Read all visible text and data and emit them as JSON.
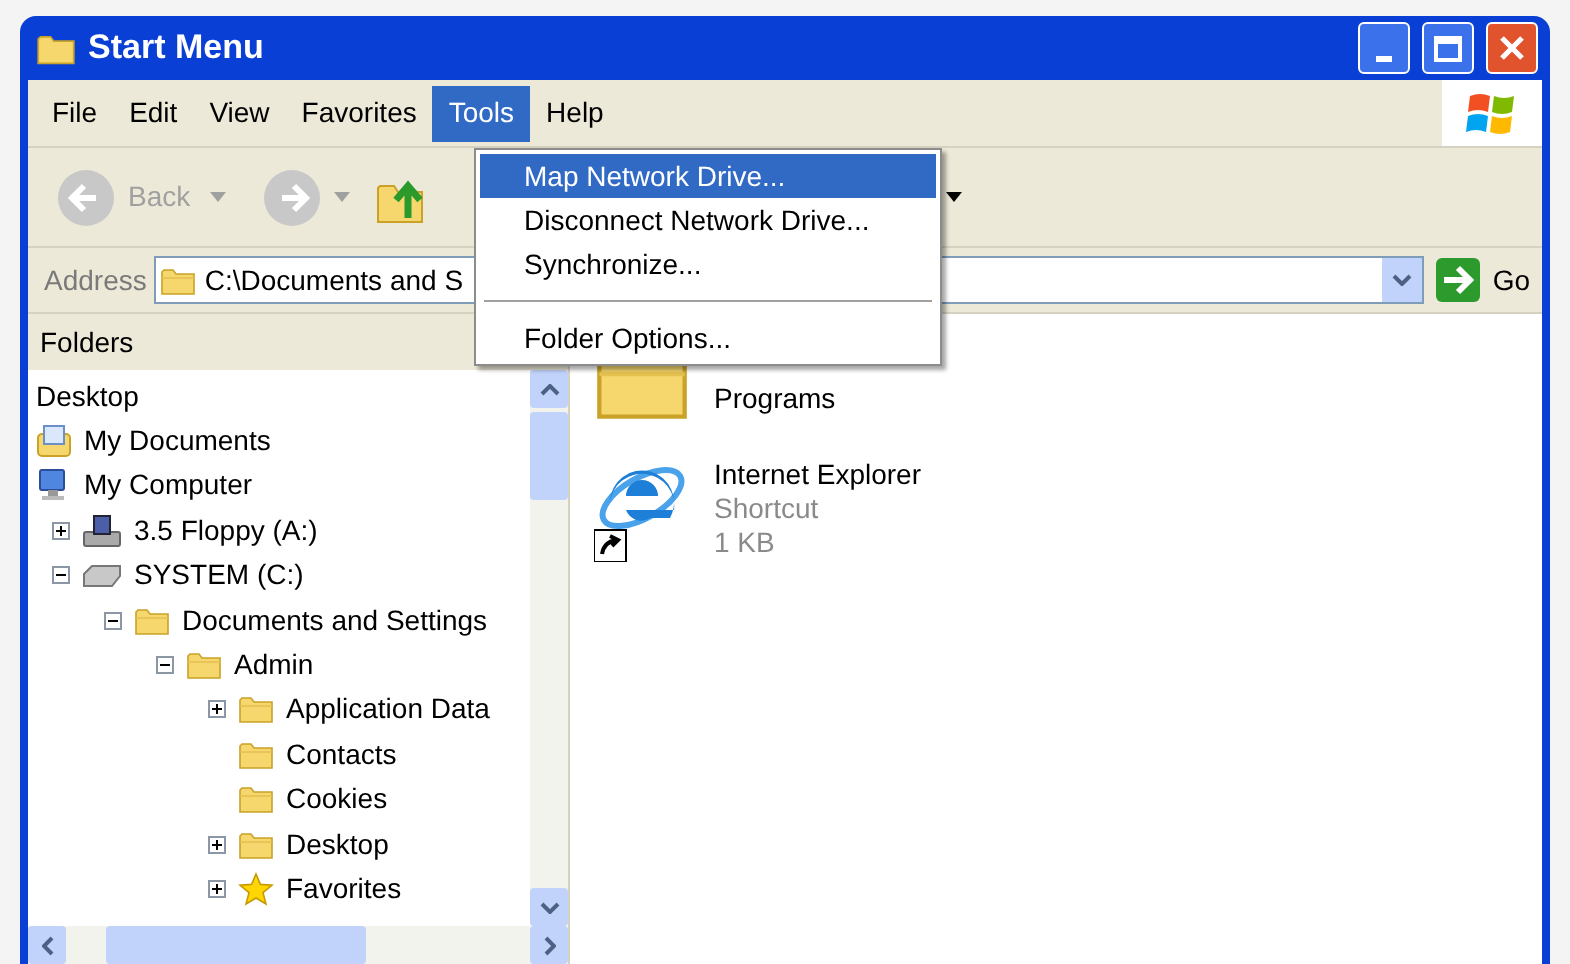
{
  "window": {
    "title": "Start Menu"
  },
  "menu_bar": [
    {
      "label": "File",
      "selected": false
    },
    {
      "label": "Edit",
      "selected": false
    },
    {
      "label": "View",
      "selected": false
    },
    {
      "label": "Favorites",
      "selected": false
    },
    {
      "label": "Tools",
      "selected": true
    },
    {
      "label": "Help",
      "selected": false
    }
  ],
  "tools_menu": [
    {
      "kind": "item",
      "label": "Map Network Drive...",
      "selected": true
    },
    {
      "kind": "item",
      "label": "Disconnect Network Drive...",
      "selected": false
    },
    {
      "kind": "item",
      "label": "Synchronize...",
      "selected": false
    },
    {
      "kind": "separator"
    },
    {
      "kind": "item",
      "label": "Folder Options...",
      "selected": false
    }
  ],
  "toolbar": {
    "back": {
      "label": "Back",
      "disabled": true
    }
  },
  "address_bar": {
    "label": "Address",
    "value": "C:\\Documents and S",
    "go": "Go"
  },
  "folders_pane": {
    "title": "Folders",
    "tree": [
      {
        "label": "Desktop",
        "kind": "desktop"
      },
      {
        "label": "My Documents",
        "kind": "documents"
      },
      {
        "label": "My Computer",
        "kind": "computer",
        "children": [
          {
            "label": "3.5 Floppy (A:)",
            "kind": "floppy",
            "expanded": false
          },
          {
            "label": "SYSTEM (C:)",
            "kind": "drive",
            "expanded": true,
            "children": [
              {
                "label": "Documents and Settings",
                "kind": "folder",
                "expanded": true,
                "children": [
                  {
                    "label": "Admin",
                    "kind": "folder",
                    "expanded": true,
                    "children": [
                      {
                        "label": "Application Data",
                        "kind": "folder",
                        "expanded": false
                      },
                      {
                        "label": "Contacts",
                        "kind": "folder"
                      },
                      {
                        "label": "Cookies",
                        "kind": "folder"
                      },
                      {
                        "label": "Desktop",
                        "kind": "folder",
                        "expanded": false
                      },
                      {
                        "label": "Favorites",
                        "kind": "favorites",
                        "expanded": false
                      }
                    ]
                  }
                ]
              }
            ]
          }
        ]
      }
    ]
  },
  "files": [
    {
      "kind": "folder",
      "name": "Programs"
    },
    {
      "kind": "shortcut",
      "name": "Internet Explorer",
      "type": "Shortcut",
      "size": "1 KB"
    }
  ]
}
